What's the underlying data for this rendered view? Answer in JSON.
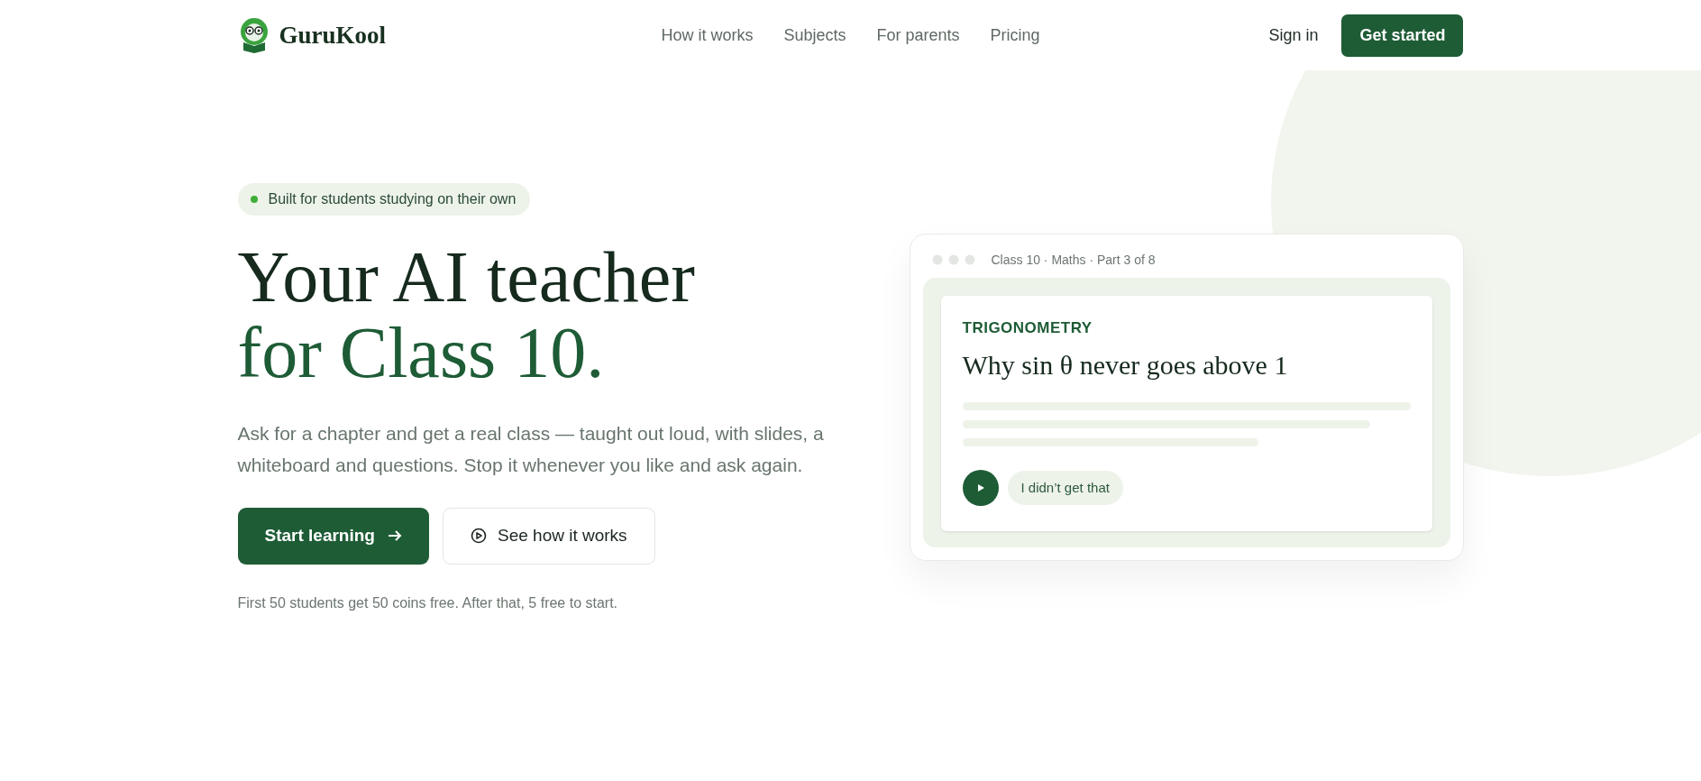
{
  "brand": {
    "name": "GuruKool"
  },
  "nav": {
    "links": [
      "How it works",
      "Subjects",
      "For parents",
      "Pricing"
    ],
    "sign_in": "Sign in",
    "cta": "Get started"
  },
  "hero": {
    "badge": "Built for students studying on their own",
    "title_line_1": "Your AI teacher",
    "title_line_2": "for Class 10.",
    "description": "Ask for a chapter and get a real class — taught out loud, with slides, a whiteboard and questions. Stop it whenever you like and ask again.",
    "primary_button": "Start learning",
    "secondary_button": "See how it works",
    "note": "First 50 students get 50 coins free. After that, 5 free to start."
  },
  "lesson_card": {
    "breadcrumb": "Class 10 · Maths · Part 3 of 8",
    "topic": "TRIGONOMETRY",
    "title": "Why sin θ never goes above 1",
    "reply_chip": "I didn’t get that"
  }
}
